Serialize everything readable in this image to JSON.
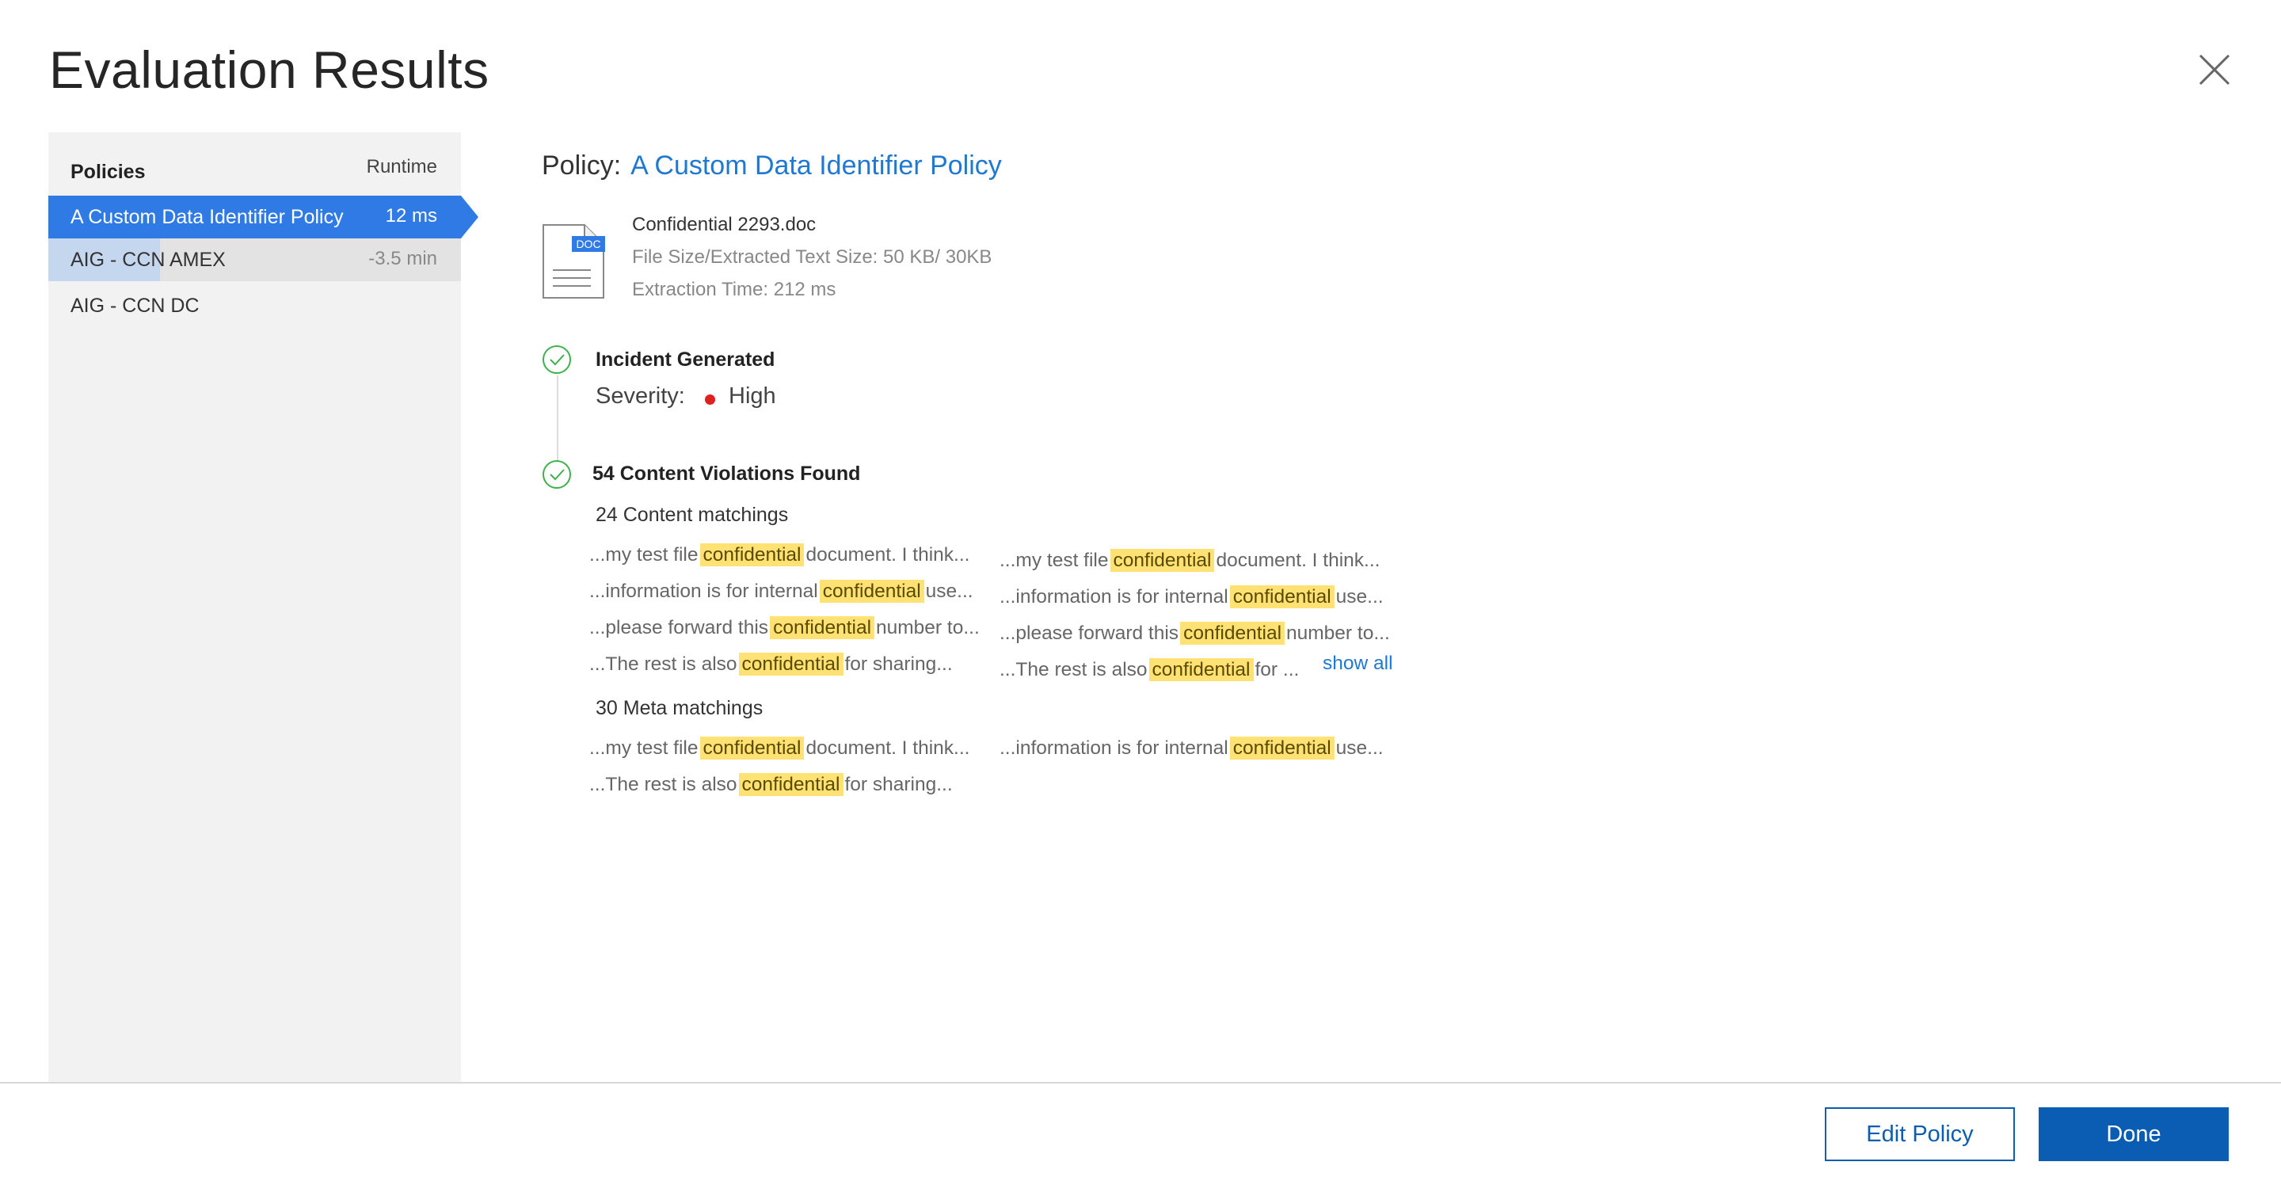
{
  "dialog": {
    "title": "Evaluation Results"
  },
  "sidebar": {
    "header": {
      "policies": "Policies",
      "runtime": "Runtime"
    },
    "items": [
      {
        "label": "A Custom Data Identifier Policy",
        "runtime": "12 ms",
        "state": "active"
      },
      {
        "label": "AIG - CCN AMEX",
        "runtime": "-3.5 min",
        "state": "loading",
        "progress": 0.27
      },
      {
        "label": "AIG - CCN DC",
        "runtime": "",
        "state": "pending"
      }
    ]
  },
  "main": {
    "policy_key": "Policy:",
    "policy_name": "A Custom Data Identifier Policy",
    "file": {
      "icon_badge": "DOC",
      "name": "Confidential 2293.doc",
      "size": "File Size/Extracted Text Size: 50 KB/ 30KB",
      "extraction": "Extraction Time: 212 ms"
    },
    "incident": {
      "title": "Incident Generated",
      "severity_key": "Severity:",
      "severity_value": "High",
      "severity_color": "#e0201e"
    },
    "violations": {
      "title": "54 Content Violations Found",
      "content_title": "24 Content matchings",
      "content_left": [
        {
          "pre": "...my test file",
          "hl": "confidential",
          "post": "document. I think..."
        },
        {
          "pre": "...information is for internal",
          "hl": "confidential",
          "post": "use..."
        },
        {
          "pre": "...please forward this",
          "hl": "confidential",
          "post": "number to..."
        },
        {
          "pre": "...The rest is also",
          "hl": "confidential",
          "post": "for sharing..."
        }
      ],
      "content_right": [
        {
          "pre": "...my test file",
          "hl": "confidential",
          "post": "document. I think..."
        },
        {
          "pre": "...information is for internal",
          "hl": "confidential",
          "post": "use..."
        },
        {
          "pre": "...please forward this",
          "hl": "confidential",
          "post": "number to..."
        },
        {
          "pre": "...The rest is also",
          "hl": "confidential",
          "post": "for ..."
        }
      ],
      "show_all": "show all",
      "meta_title": "30 Meta matchings",
      "meta_left": [
        {
          "pre": "...my test file",
          "hl": "confidential",
          "post": "document. I think..."
        },
        {
          "pre": "...The rest is also",
          "hl": "confidential",
          "post": "for sharing..."
        }
      ],
      "meta_right": [
        {
          "pre": "...information is for internal",
          "hl": "confidential",
          "post": "use..."
        }
      ]
    }
  },
  "footer": {
    "edit_label": "Edit Policy",
    "done_label": "Done"
  },
  "colors": {
    "accent": "#2f7ae5",
    "link": "#1f78d1",
    "primary_button": "#0a5db2",
    "highlight": "#ffe174",
    "check": "#3cb34a"
  }
}
